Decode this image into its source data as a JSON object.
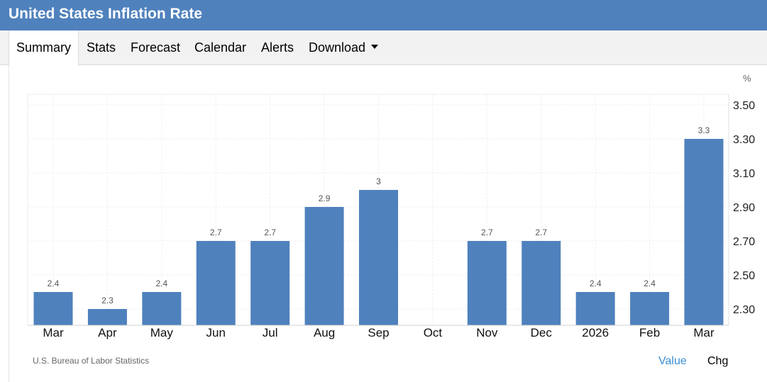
{
  "header": {
    "title": "United States Inflation Rate"
  },
  "tabs": [
    {
      "label": "Summary"
    },
    {
      "label": "Stats"
    },
    {
      "label": "Forecast"
    },
    {
      "label": "Calendar"
    },
    {
      "label": "Alerts"
    },
    {
      "label": "Download"
    }
  ],
  "footer": {
    "source": "U.S. Bureau of Labor Statistics",
    "value_label": "Value",
    "chg_label": "Chg"
  },
  "colors": {
    "bar": "#4f81bd",
    "header": "#4f81bd",
    "active_toggle": "#3a8fd6"
  },
  "chart_data": {
    "type": "bar",
    "unit": "%",
    "categories": [
      "Mar",
      "Apr",
      "May",
      "Jun",
      "Jul",
      "Aug",
      "Sep",
      "Oct",
      "Nov",
      "Dec",
      "2026",
      "Feb",
      "Mar"
    ],
    "values": [
      2.4,
      2.3,
      2.4,
      2.7,
      2.7,
      2.9,
      3,
      null,
      2.7,
      2.7,
      2.4,
      2.4,
      3.3
    ],
    "data_labels": [
      "2.4",
      "2.3",
      "2.4",
      "2.7",
      "2.7",
      "2.9",
      "3",
      "",
      "2.7",
      "2.7",
      "2.4",
      "2.4",
      "3.3"
    ],
    "y_ticks": [
      "2.30",
      "2.50",
      "2.70",
      "2.90",
      "3.10",
      "3.30",
      "3.50"
    ],
    "y_axis_side": "right",
    "grid": true
  }
}
